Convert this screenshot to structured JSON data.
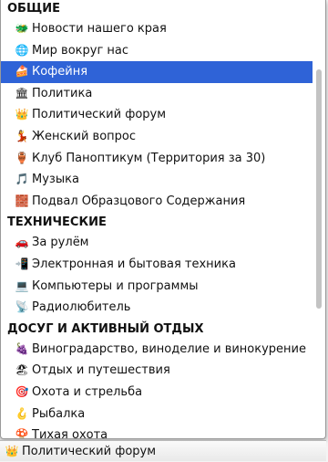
{
  "dropdown": {
    "groups": [
      {
        "label": "ОБЩИЕ",
        "items": [
          {
            "icon": "🐲",
            "label": "Новости нашего края"
          },
          {
            "icon": "🌐",
            "label": "Мир вокруг нас"
          },
          {
            "icon": "🍰",
            "label": "Кофейня",
            "selected": true
          },
          {
            "icon": "🏛",
            "label": "Политика"
          },
          {
            "icon": "👑",
            "label": "Политический форум"
          },
          {
            "icon": "💃",
            "label": "Женский вопрос"
          },
          {
            "icon": "🏺",
            "label": "Клуб Паноптикум (Территория за 30)"
          },
          {
            "icon": "🎵",
            "label": "Музыка"
          },
          {
            "icon": "🧱",
            "label": "Подвал Образцового Содержания"
          }
        ]
      },
      {
        "label": "ТЕХНИЧЕСКИЕ",
        "items": [
          {
            "icon": "🚗",
            "label": "За рулём"
          },
          {
            "icon": "📲",
            "label": "Электронная и бытовая техника"
          },
          {
            "icon": "💻",
            "label": "Компьютеры и программы"
          },
          {
            "icon": "📡",
            "label": "Радиолюбитель"
          }
        ]
      },
      {
        "label": "ДОСУГ И АКТИВНЫЙ ОТДЫХ",
        "items": [
          {
            "icon": "🍇",
            "label": "Виноградарство, виноделие и винокурение"
          },
          {
            "icon": "🏖",
            "label": "Отдых и путешествия"
          },
          {
            "icon": "🎯",
            "label": "Охота и стрельба"
          },
          {
            "icon": "🪝",
            "label": "Рыбалка"
          },
          {
            "icon": "🍄",
            "label": "Тихая охота"
          }
        ]
      }
    ],
    "accent_color": "#2f63d7"
  },
  "select": {
    "icon": "👑",
    "value": "Политический форум"
  }
}
